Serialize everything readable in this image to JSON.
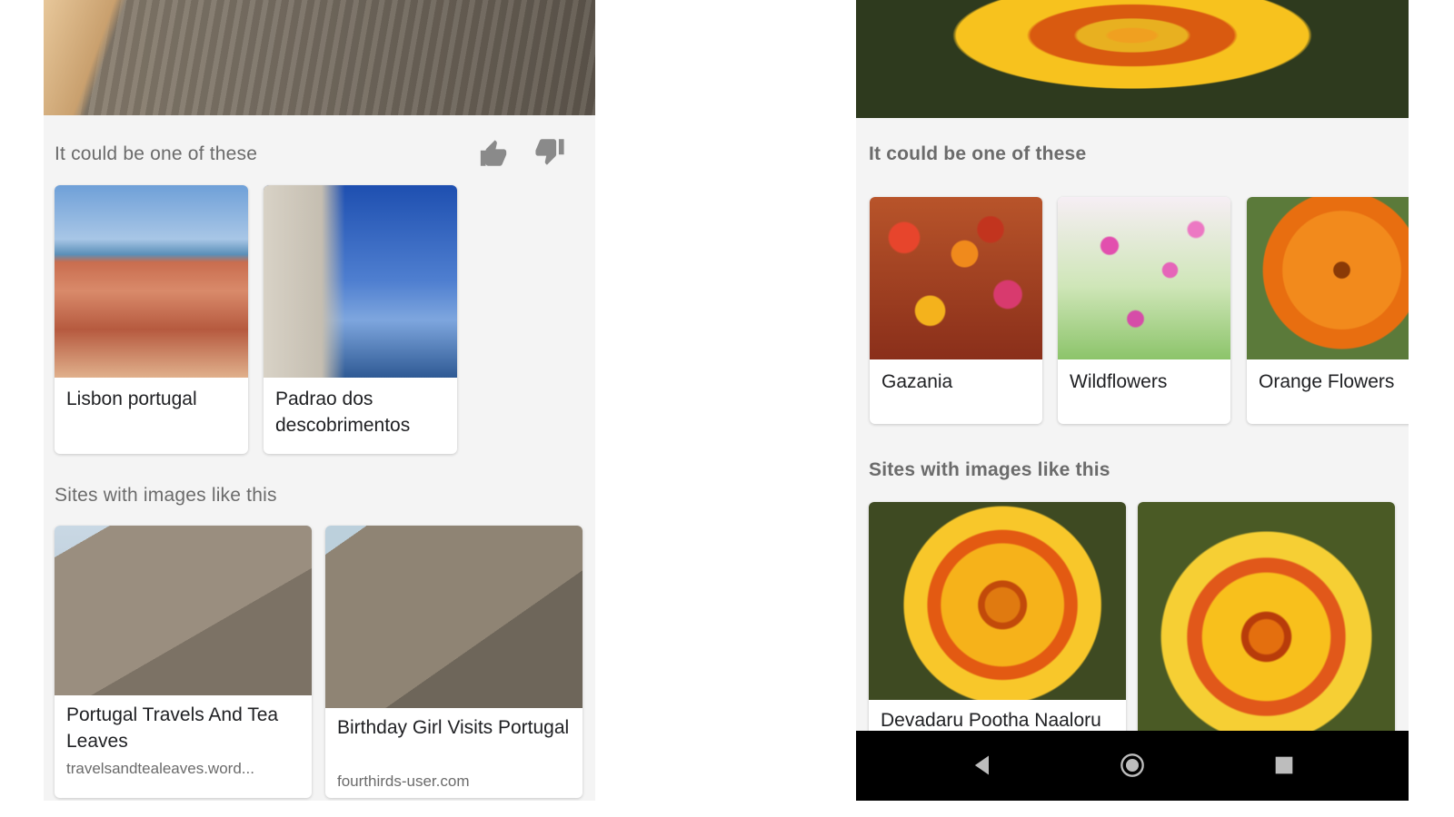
{
  "left": {
    "suggestions_heading": "It could be one of these",
    "suggestions": [
      {
        "title": "Lisbon portugal"
      },
      {
        "title": "Padrao dos descobrimentos"
      }
    ],
    "sites_heading": "Sites with images like this",
    "sites": [
      {
        "title": "Portugal Travels And Tea Leaves",
        "source": "travelsandtealeaves.word..."
      },
      {
        "title": "Birthday Girl Visits Portugal",
        "source": "fourthirds-user.com"
      }
    ],
    "feedback_icons": [
      "thumbs-up-icon",
      "thumbs-down-icon"
    ]
  },
  "right": {
    "suggestions_heading": "It could be one of these",
    "suggestions": [
      {
        "title": "Gazania"
      },
      {
        "title": "Wildflowers"
      },
      {
        "title": "Orange Flowers"
      }
    ],
    "sites_heading": "Sites with images like this",
    "sites": [
      {
        "title": "Devadaru Pootha Naaloru"
      },
      {
        "title": ""
      }
    ],
    "nav_icons": [
      "back-triangle-icon",
      "home-circle-icon",
      "recents-square-icon"
    ]
  }
}
